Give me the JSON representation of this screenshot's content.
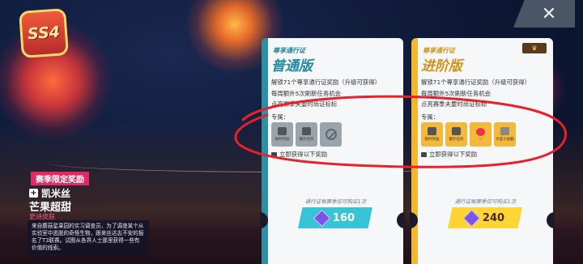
{
  "close": {
    "label": "✕"
  },
  "badge": {
    "text": "SS4"
  },
  "left": {
    "season_label": "赛季限定奖励",
    "skin_type": "凯米丝",
    "skin_name": "芒果超甜",
    "rarity": "史诗皮肤",
    "lore": "来自蘑菇星果园的实习调查员，为了调查某个从实验室中逃脱的奇怪生物，跟来丝达志不安的报名了T3联赛。试图从各界人士那里获得一些有价值的线索。"
  },
  "cards": {
    "normal": {
      "title_small": "尊享通行证",
      "title": "普通版",
      "bullets": [
        "解锁71个尊享通行证奖励（升级可获得）",
        "每周额外5次刷新任务机会",
        "点亮赛季夫要时尚证标标"
      ],
      "reward_label": "专属：",
      "slots": [
        "限时奖励",
        "额外任务",
        ""
      ],
      "instant": "立即获得以下奖励",
      "limit": "通行证每赛季仅可购买1次",
      "price": "160"
    },
    "advanced": {
      "title_small": "尊享通行证",
      "title": "进阶版",
      "bullets": [
        "解锁71个尊享通行证奖励（升级可获得）",
        "每周额外5次刷新任务机会",
        "点亮赛季夫要时尚证标标"
      ],
      "reward_label": "专属：",
      "slots": [
        "限时奖励",
        "额外任务",
        "—",
        "大型小伯勤"
      ],
      "instant": "立即获得以下奖励",
      "limit": "通行证每赛季仅可购买1次",
      "price": "240"
    }
  },
  "colors": {
    "normal_accent": "#2d8fa6",
    "advanced_accent": "#f3b62f",
    "annotation": "#e8202a"
  }
}
